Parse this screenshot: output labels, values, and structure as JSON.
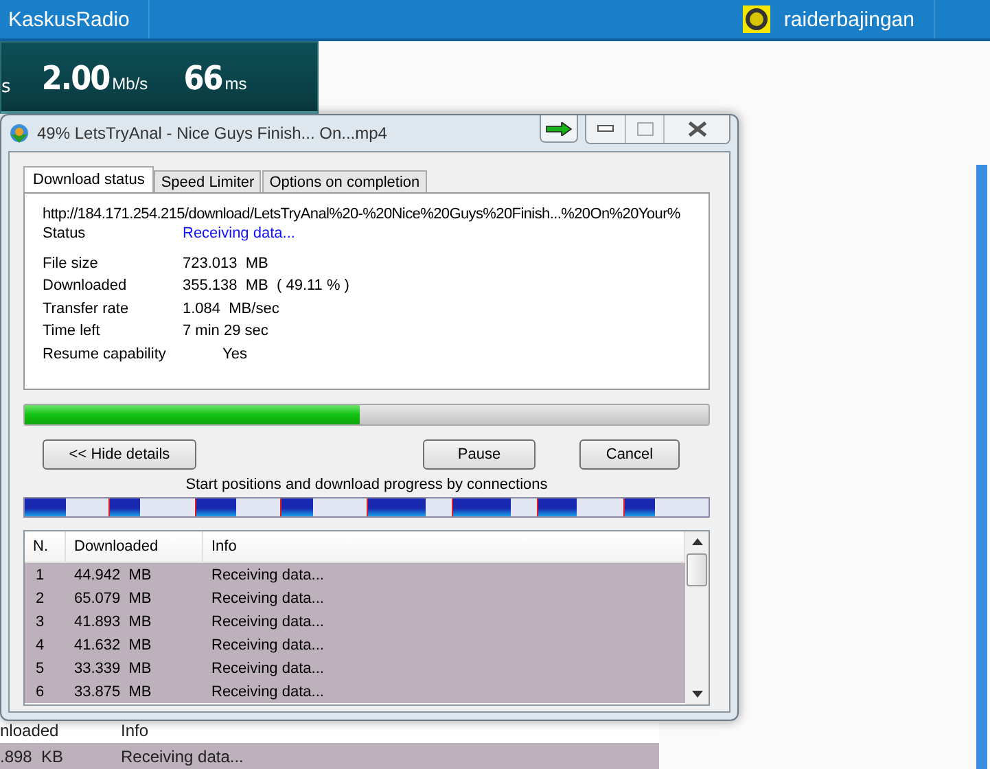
{
  "topbar": {
    "brand": "KaskusRadio",
    "user": "raiderbajingan"
  },
  "speedtest": {
    "cut_unit": "s",
    "upload": {
      "value": "2.00",
      "unit": "Mb/s"
    },
    "ping": {
      "value": "66",
      "unit": "ms"
    }
  },
  "background_list": {
    "columns": [
      "nloaded",
      "Info"
    ],
    "rows": [
      [
        ".898  KB",
        "Receiving data..."
      ]
    ]
  },
  "dialog": {
    "title": "49% LetsTryAnal - Nice Guys Finish... On...mp4",
    "tabs": [
      {
        "label": "Download status",
        "selected": true
      },
      {
        "label": "Speed Limiter",
        "selected": false
      },
      {
        "label": "Options on completion",
        "selected": false
      }
    ],
    "url": "http://184.171.254.215/download/LetsTryAnal%20-%20Nice%20Guys%20Finish...%20On%20Your%",
    "status": {
      "label": "Status",
      "value": "Receiving data..."
    },
    "fields": [
      {
        "label": "File size",
        "value": "723.013  MB"
      },
      {
        "label": "Downloaded",
        "value": "355.138  MB  ( 49.11 % )"
      },
      {
        "label": "Transfer rate",
        "value": "1.084  MB/sec"
      },
      {
        "label": "Time left",
        "value": "7 min 29 sec"
      },
      {
        "label": "Resume capability",
        "value": "Yes"
      }
    ],
    "progress": {
      "level": 0.49
    },
    "buttons": [
      "<< Hide details",
      "Pause",
      "Cancel"
    ],
    "connections_caption": "Start positions and download progress by connections",
    "connections": [
      {
        "level": 0.49
      },
      {
        "level": 0.36
      },
      {
        "level": 0.47
      },
      {
        "level": 0.38
      },
      {
        "level": 0.7
      },
      {
        "level": 0.68
      },
      {
        "level": 0.45
      },
      {
        "level": 0.36
      }
    ],
    "table": {
      "columns": [
        "N.",
        "Downloaded",
        "Info"
      ],
      "rows": [
        [
          "1",
          "44.942  MB",
          "Receiving data..."
        ],
        [
          "2",
          "65.079  MB",
          "Receiving data..."
        ],
        [
          "3",
          "41.893  MB",
          "Receiving data..."
        ],
        [
          "4",
          "41.632  MB",
          "Receiving data..."
        ],
        [
          "5",
          "33.339  MB",
          "Receiving data..."
        ],
        [
          "6",
          "33.875  MB",
          "Receiving data..."
        ]
      ]
    }
  }
}
